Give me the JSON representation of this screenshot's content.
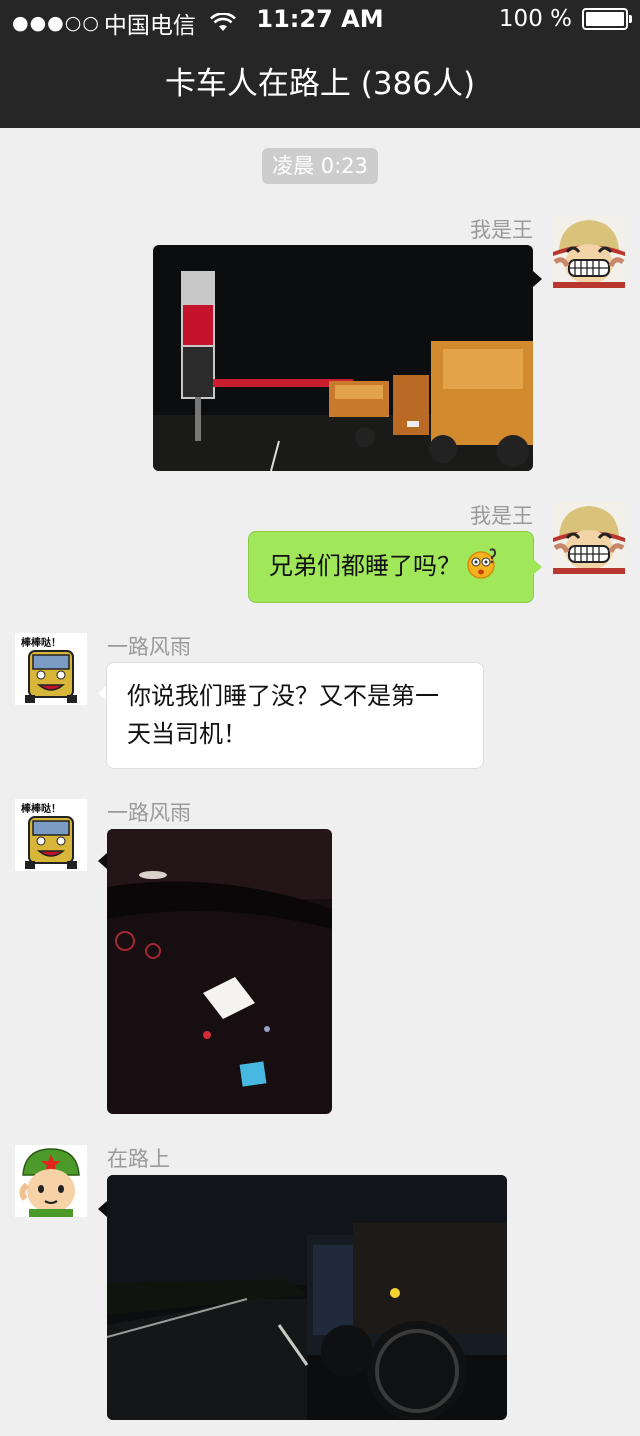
{
  "status_bar": {
    "signal": "●●●○○",
    "carrier": "中国电信",
    "time": "11:27 AM",
    "battery": "100 %"
  },
  "nav": {
    "title": "卡车人在路上 (386人)"
  },
  "timestamp": "凌晨 0:23",
  "messages": [
    {
      "sender": "我是王",
      "type": "image",
      "side": "right",
      "avatar": "luffy-avatar"
    },
    {
      "sender": "我是王",
      "type": "text",
      "side": "right",
      "text": "兄弟们都睡了吗？",
      "emoji": "dizzy-face-emoji",
      "avatar": "luffy-avatar"
    },
    {
      "sender": "一路风雨",
      "type": "text",
      "side": "left",
      "text_line1": "你说我们睡了没？又不是第一",
      "text_line2": "天当司机！",
      "avatar": "truck-cartoon-avatar",
      "avatar_caption": "棒棒哒！"
    },
    {
      "sender": "一路风雨",
      "type": "image",
      "side": "left",
      "avatar": "truck-cartoon-avatar",
      "avatar_caption": "棒棒哒！"
    },
    {
      "sender": "在路上",
      "type": "image",
      "side": "left",
      "avatar": "soldier-cartoon-avatar"
    }
  ],
  "colors": {
    "bar": "#262626",
    "background": "#efefef",
    "green_bubble": "#a0e75a",
    "sender_text": "#9a9a9a"
  }
}
